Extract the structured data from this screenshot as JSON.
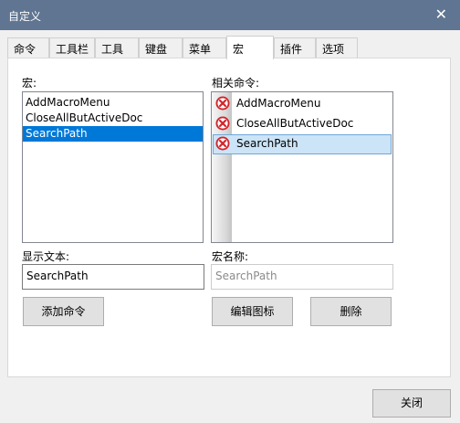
{
  "window": {
    "title": "自定义",
    "close_glyph": "✕"
  },
  "tabs": [
    {
      "label": "命令"
    },
    {
      "label": "工具栏"
    },
    {
      "label": "工具"
    },
    {
      "label": "键盘"
    },
    {
      "label": "菜单"
    },
    {
      "label": "宏",
      "active": true
    },
    {
      "label": "插件"
    },
    {
      "label": "选项"
    }
  ],
  "macros": {
    "label": "宏:",
    "items": [
      "AddMacroMenu",
      "CloseAllButActiveDoc",
      "SearchPath"
    ],
    "selected": "SearchPath"
  },
  "commands": {
    "label": "相关命令:",
    "items": [
      {
        "label": "AddMacroMenu",
        "icon": "error-x-icon"
      },
      {
        "label": "CloseAllButActiveDoc",
        "icon": "error-x-icon"
      },
      {
        "label": "SearchPath",
        "icon": "error-x-icon"
      }
    ],
    "selected": "SearchPath"
  },
  "display_text": {
    "label": "显示文本:",
    "value": "SearchPath"
  },
  "macro_name": {
    "label": "宏名称:",
    "value": "SearchPath"
  },
  "buttons": {
    "add_command": "添加命令",
    "edit_icon": "编辑图标",
    "delete": "删除",
    "close": "关闭"
  },
  "colors": {
    "titlebar": "#5f7591",
    "selection": "#0078d7",
    "cmd_selection": "#cce4f7",
    "error_icon": "#d2252c"
  }
}
